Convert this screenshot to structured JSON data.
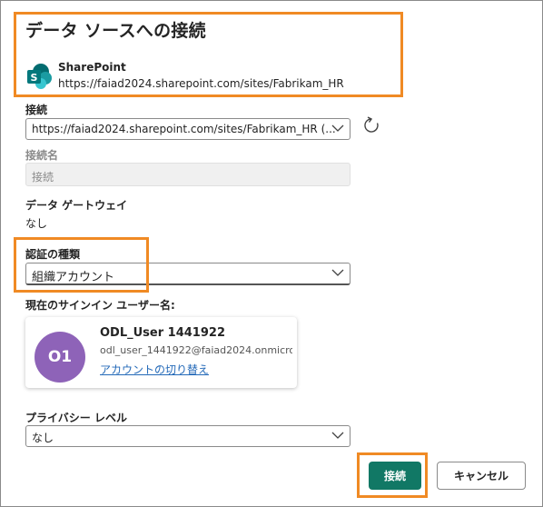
{
  "dialog": {
    "title": "データ ソースへの接続"
  },
  "source": {
    "name": "SharePoint",
    "url": "https://faiad2024.sharepoint.com/sites/Fabrikam_HR",
    "icon": "sharepoint-icon",
    "icon_colors": [
      "#036c70",
      "#1a9ba1",
      "#37c6d0"
    ]
  },
  "connection": {
    "label": "接続",
    "value": "https://faiad2024.sharepoint.com/sites/Fabrikam_HR (..."
  },
  "connection_name": {
    "label": "接続名",
    "placeholder": "接続"
  },
  "gateway": {
    "label": "データ ゲートウェイ",
    "value": "なし"
  },
  "auth": {
    "label": "認証の種類",
    "value": "組織アカウント"
  },
  "signed_in": {
    "label": "現在のサインイン ユーザー名:",
    "avatar_initials": "O1",
    "avatar_color": "#8e63b8",
    "user_name": "ODL_User 1441922",
    "email": "odl_user_1441922@faiad2024.onmicro...",
    "switch_link": "アカウントの切り替え"
  },
  "privacy": {
    "label": "プライバシー レベル",
    "value": "なし"
  },
  "buttons": {
    "connect": "接続",
    "cancel": "キャンセル"
  },
  "colors": {
    "primary": "#117865",
    "link": "#2369b8",
    "highlight": "#f08a24"
  }
}
